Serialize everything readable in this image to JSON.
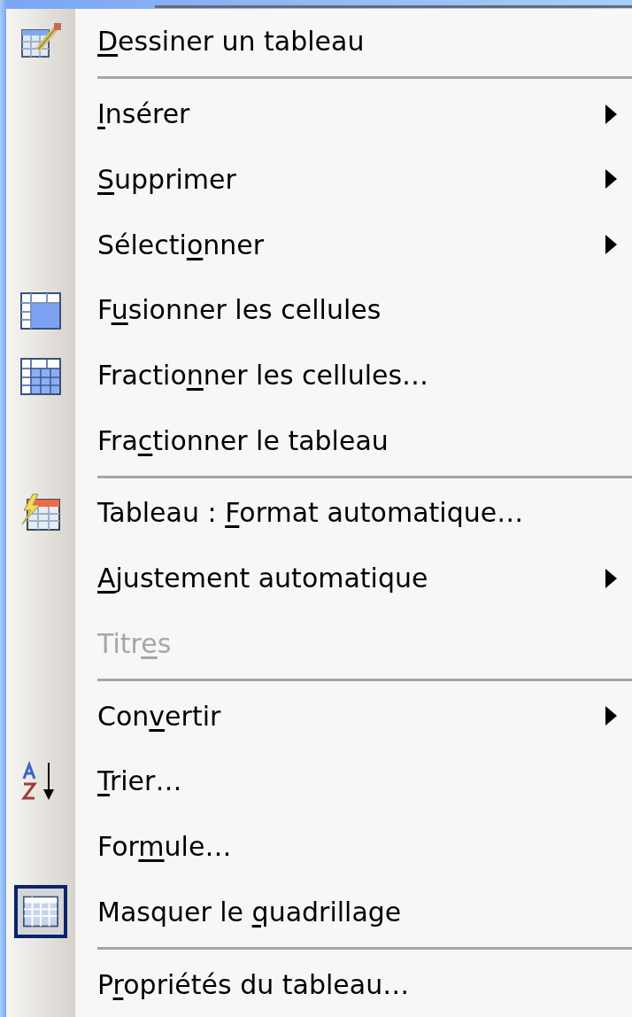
{
  "menu": {
    "items": [
      {
        "kind": "pencil",
        "key": "D",
        "after": "essiner un tableau",
        "disabled": false
      },
      {
        "kind": "separator"
      },
      {
        "kind": "plain",
        "key": "I",
        "after": "nsérer",
        "submenu": true,
        "disabled": false
      },
      {
        "kind": "plain",
        "key": "S",
        "after": "upprimer",
        "submenu": true,
        "disabled": false
      },
      {
        "kind": "plain",
        "before": "Sélecti",
        "key": "o",
        "after": "nner",
        "submenu": true,
        "disabled": false
      },
      {
        "kind": "merge",
        "before": "F",
        "key": "u",
        "after": "sionner les cellules",
        "disabled": false
      },
      {
        "kind": "split",
        "before": "Fractio",
        "key": "n",
        "after": "ner les cellules…",
        "disabled": false
      },
      {
        "kind": "plain",
        "before": "Fra",
        "key": "c",
        "after": "tionner le tableau",
        "disabled": false
      },
      {
        "kind": "separator"
      },
      {
        "kind": "autoformat",
        "before": "Tableau : ",
        "key": "F",
        "after": "ormat automatique…",
        "disabled": false
      },
      {
        "kind": "plain",
        "key": "A",
        "after": "justement automatique",
        "submenu": true,
        "disabled": false
      },
      {
        "kind": "plain",
        "before": "Titr",
        "key": "e",
        "after": "s",
        "disabled": true
      },
      {
        "kind": "separator"
      },
      {
        "kind": "plain",
        "before": "Con",
        "key": "v",
        "after": "ertir",
        "submenu": true,
        "disabled": false
      },
      {
        "kind": "sort",
        "key": "T",
        "after": "rier…",
        "disabled": false
      },
      {
        "kind": "plain",
        "before": "For",
        "key": "m",
        "after": "ule…",
        "disabled": false
      },
      {
        "kind": "grid",
        "before": "Masquer le ",
        "key": "q",
        "after": "uadrillage",
        "checked": true,
        "disabled": false
      },
      {
        "kind": "separator"
      },
      {
        "kind": "plain",
        "before": "P",
        "key": "r",
        "after": "opriétés du tableau…",
        "disabled": false
      }
    ]
  }
}
